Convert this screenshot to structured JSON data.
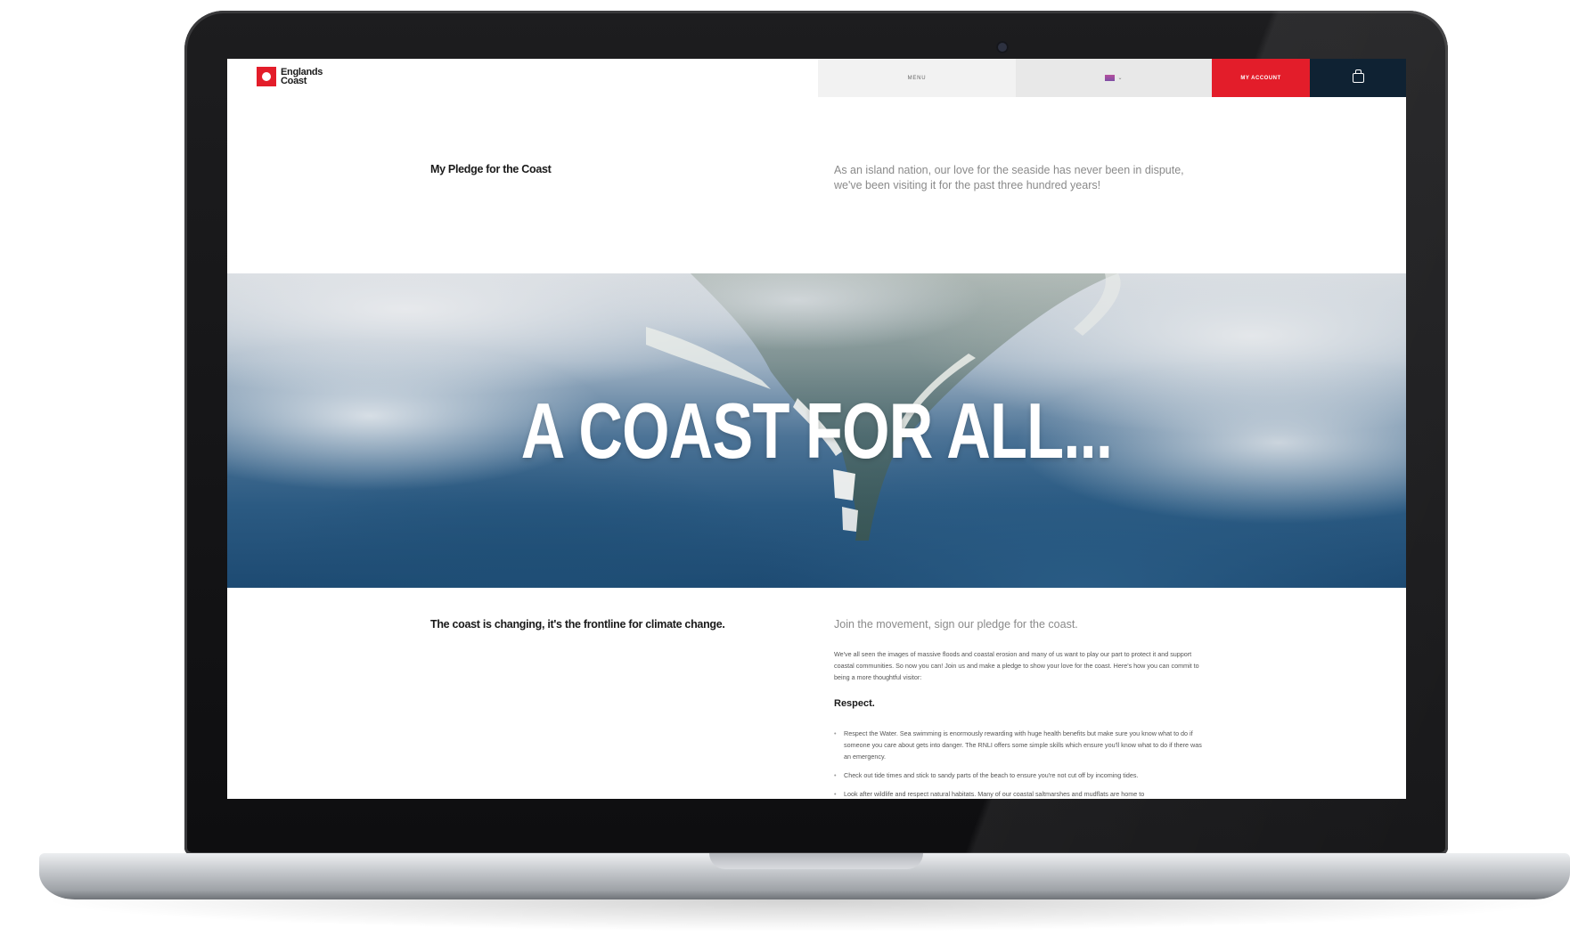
{
  "site": {
    "logo_text": "Englands Coast",
    "nav": {
      "menu_label": "MENU",
      "lang_caret": "⌄",
      "account_label": "MY ACCOUNT"
    },
    "brand_color": "#e31d2a",
    "dark_color": "#0f2233"
  },
  "intro": {
    "title": "My Pledge for the Coast",
    "text": "As an island nation, our love for the seaside has never been in dispute, we've been visiting it for the past three hundred years!"
  },
  "hero": {
    "title": "A COAST FOR ALL..."
  },
  "section": {
    "title": "The coast is changing, it's the frontline for climate change.",
    "lead": "Join the movement, sign our pledge for the coast.",
    "body": "We've all seen the images of massive floods and coastal erosion and many of us want to play our part to protect it and support coastal communities. So now you can! Join us and make a pledge to show your love for the coast. Here's how you can commit to being a more thoughtful visitor:",
    "respect_title": "Respect.",
    "tips": [
      "Respect the Water. Sea swimming is enormously rewarding with huge health benefits but make sure you know what to do if someone you care about gets into danger. The RNLI offers some simple skills which ensure you'll know what to do if there was an emergency.",
      "Check out tide times and stick to sandy parts of the beach to ensure you're not cut off by incoming tides.",
      "Look after wildlife and respect natural habitats. Many of our coastal saltmarshes and mudflats are home to"
    ]
  }
}
